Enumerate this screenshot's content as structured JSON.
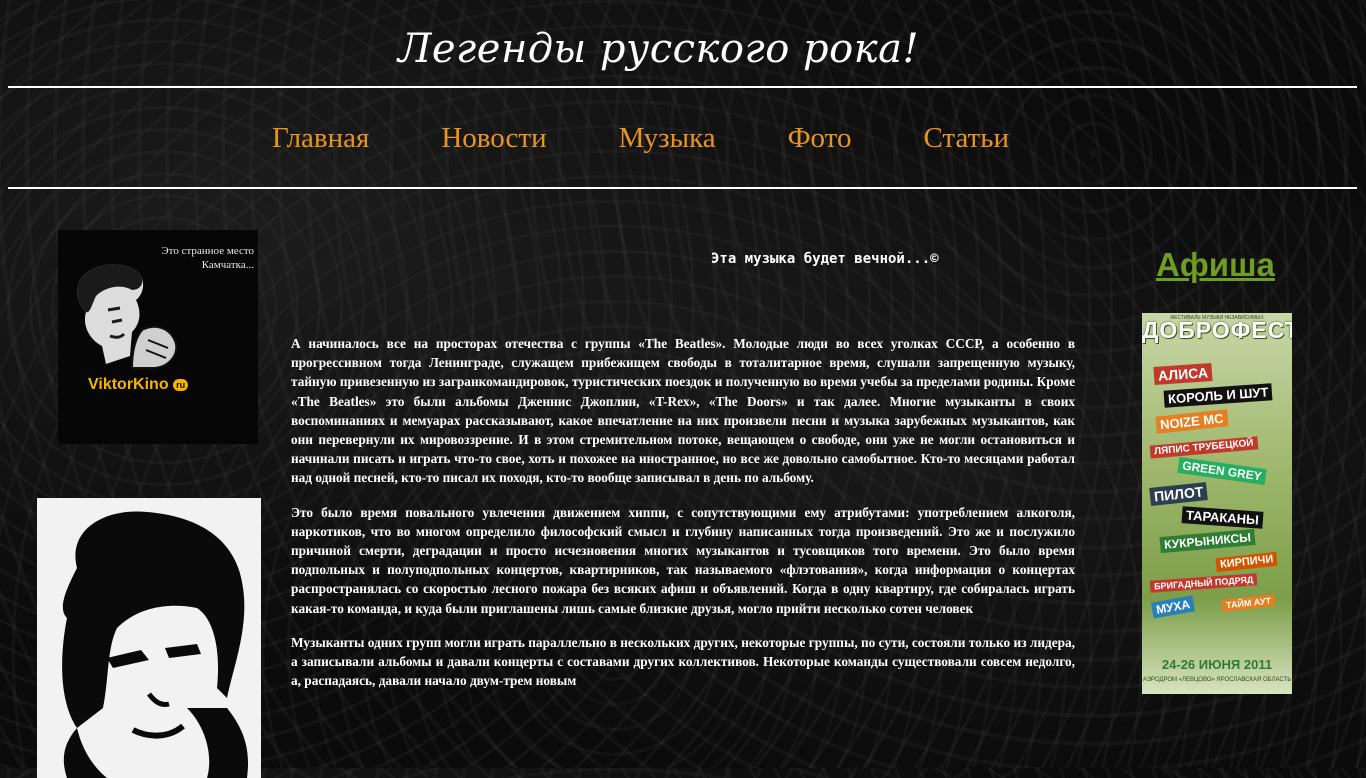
{
  "header": {
    "site_title": "Легенды русского рока!"
  },
  "nav": {
    "items": [
      {
        "label": "Главная"
      },
      {
        "label": "Новости"
      },
      {
        "label": "Музыка"
      },
      {
        "label": "Фото"
      },
      {
        "label": "Статьи"
      }
    ],
    "color": "#e8951f"
  },
  "left": {
    "banner_caption_line1": "Это странное место",
    "banner_caption_line2": "Камчатка...",
    "banner_brand": "ViktorKino",
    "banner_brand_suffix": "ru"
  },
  "main": {
    "slogan": "Эта музыка будет вечной...©",
    "paragraphs": [
      "А начиналось все на просторах отечества с группы «The Beatles». Молодые люди во всех уголках СССР, а особенно в прогрессивном тогда Ленинграде, служащем прибежищем свободы в тоталитарное время, слушали запрещенную музыку, тайную привезенную из загранкомандировок, туристических поездок и полученную во время учебы за пределами родины. Кроме «The Beatles» это были альбомы Дженнис Джоплин, «T-Rex», «The Doors» и так далее. Многие музыканты в своих воспоминаниях и мемуарах рассказывают, какое впечатление на них произвели песни и музыка зарубежных музыкантов, как они перевернули их мировоззрение. И в этом стремительном потоке, вещающем о свободе, они уже не могли остановиться и начинали писать и играть что-то свое, хоть и похожее на иностранное, но все же довольно самобытное. Кто-то месяцами работал над одной песней, кто-то писал их походя, кто-то вообще записывал в день по альбому.",
      "Это было время повального увлечения движением хиппи, с сопутствующими ему атрибутами: употреблением алкоголя, наркотиков, что во многом определило философский смысл и глубину написанных тогда произведений. Это же и послужило причиной смерти, деградации и просто исчезновения многих музыкантов и тусовщиков того времени. Это было время подпольных и полуподпольных концертов, квартирников, так называемого «флэтования», когда информация о концертах распространялась со скоростью лесного пожара без всяких афиш и объявлений. Когда в одну квартиру, где собиралась играть какая-то команда, и куда были приглашены лишь самые близкие друзья, могло прийти несколько сотен человек",
      "Музыканты одних групп могли играть параллельно в нескольких других, некоторые группы, по сути, состояли только из лидера, а записывали альбомы и давали концерты с составами других коллективов. Некоторые команды существовали совсем недолго, а, распадаясь, давали начало двум-трем новым"
    ]
  },
  "right": {
    "heading": "Афиша",
    "heading_color": "#6f9c22",
    "poster": {
      "subtitle": "ФЕСТИВАЛЬ МУЗЫКИ НЕЗАВИСИМЫХ",
      "title": "ДОБРОФЕСТ",
      "bands": [
        {
          "name": "АЛИСА",
          "color": "#c0392b"
        },
        {
          "name": "КОРОЛЬ И ШУТ",
          "color": "#111111"
        },
        {
          "name": "NOIZE MC",
          "color": "#e67e22"
        },
        {
          "name": "ЛЯПИС ТРУБЕЦКОЙ",
          "color": "#c0392b"
        },
        {
          "name": "GREEN GREY",
          "color": "#27ae60"
        },
        {
          "name": "ПИЛОТ",
          "color": "#2c3e50"
        },
        {
          "name": "ТАРАКАНЫ",
          "color": "#111111"
        },
        {
          "name": "КУКРЫНИКСЫ",
          "color": "#2e7d32"
        },
        {
          "name": "КИРПИЧИ",
          "color": "#d35400"
        },
        {
          "name": "БРИГАДНЫЙ ПОДРЯД",
          "color": "#c0392b"
        },
        {
          "name": "МУХА",
          "color": "#2980b9"
        },
        {
          "name": "ТАЙМ АУТ",
          "color": "#e67e22"
        }
      ],
      "dates": "24-26 ИЮНЯ 2011",
      "address": "АЭРОДРОМ «ЛЕВЦОВО» ЯРОСЛАВСКАЯ ОБЛАСТЬ"
    }
  }
}
